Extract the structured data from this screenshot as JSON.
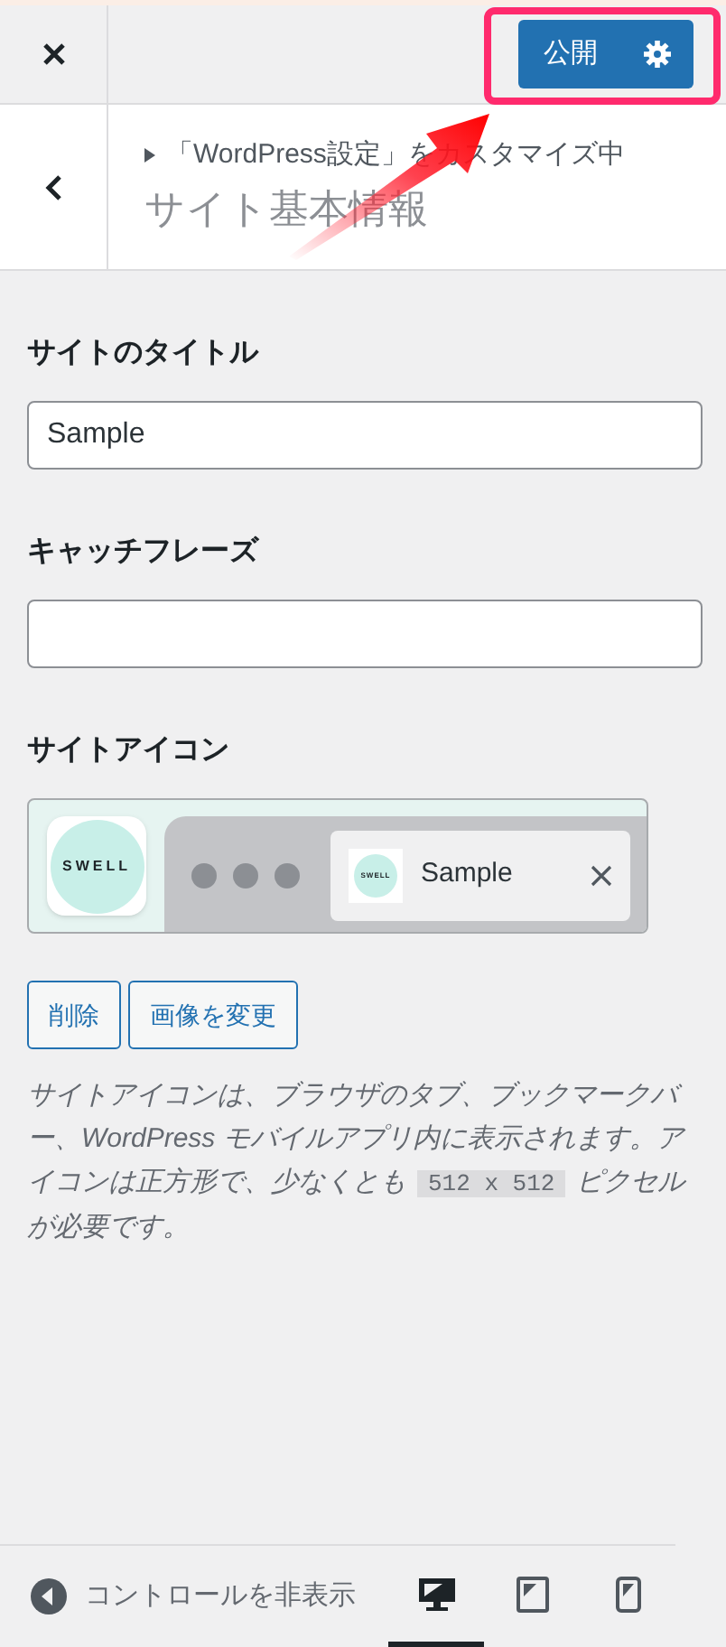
{
  "header": {
    "publish_button": "公開"
  },
  "section_header": {
    "breadcrumb": "「WordPress設定」をカスタマイズ中",
    "title": "サイト基本情報"
  },
  "fields": [
    {
      "label": "サイトのタイトル",
      "value": "Sample"
    },
    {
      "label": "キャッチフレーズ"
    }
  ],
  "site_icon": {
    "label": "サイトアイコン",
    "app_logo_text": "SWELL",
    "tab_logo_text": "SWELL",
    "tab_title": "Sample",
    "buttons": [
      "削除",
      "画像を変更"
    ],
    "description": {
      "before": "サイトアイコンは、ブラウザのタブ、ブックマークバー、WordPress モバイルアプリ内に表示されます。アイコンは正方形で、少なくとも",
      "code": "512 x 512",
      "after": "ピクセルが必要です。"
    }
  },
  "footer": {
    "hide_controls": "コントロールを非表示",
    "devices": [
      {
        "kind": "desktop",
        "selected": true
      },
      {
        "kind": "tablet",
        "selected": false
      },
      {
        "kind": "mobile",
        "selected": false
      }
    ]
  }
}
